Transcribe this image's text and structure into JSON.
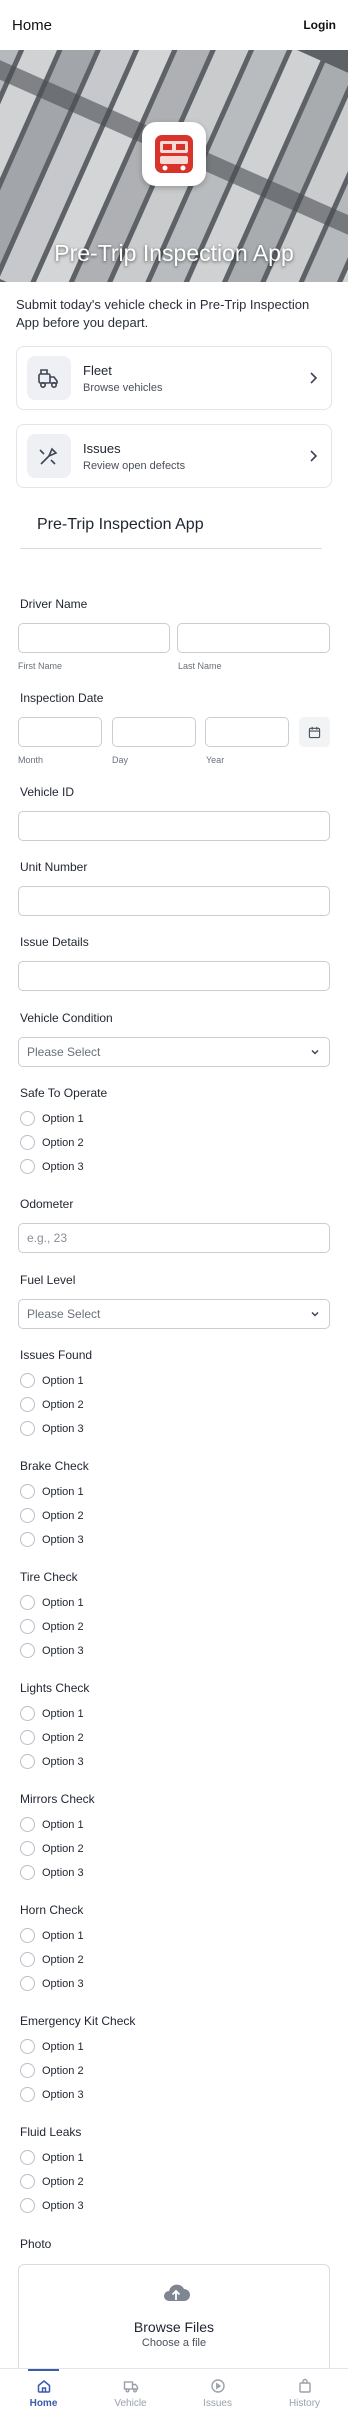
{
  "header": {
    "title": "Home",
    "login_label": "Login"
  },
  "hero": {
    "title": "Pre-Trip Inspection App"
  },
  "intro": "Submit today's vehicle check in Pre-Trip Inspection App before you depart.",
  "cards": [
    {
      "title": "Fleet",
      "subtitle": "Browse vehicles",
      "icon": "forklift-icon"
    },
    {
      "title": "Issues",
      "subtitle": "Review open defects",
      "icon": "tools-icon"
    }
  ],
  "form": {
    "title": "Pre-Trip Inspection App",
    "driver_name": {
      "label": "Driver Name",
      "first": "First Name",
      "last": "Last Name"
    },
    "inspection_date": {
      "label": "Inspection Date",
      "month": "Month",
      "day": "Day",
      "year": "Year"
    },
    "vehicle_id": {
      "label": "Vehicle ID"
    },
    "unit_number": {
      "label": "Unit Number"
    },
    "issue_details": {
      "label": "Issue Details"
    },
    "vehicle_condition": {
      "label": "Vehicle Condition",
      "placeholder": "Please Select"
    },
    "safe_to_operate": {
      "label": "Safe To Operate",
      "options": [
        "Option 1",
        "Option 2",
        "Option 3"
      ]
    },
    "odometer": {
      "label": "Odometer",
      "placeholder": "e.g., 23"
    },
    "fuel_level": {
      "label": "Fuel Level",
      "placeholder": "Please Select"
    },
    "issues_found": {
      "label": "Issues Found",
      "options": [
        "Option 1",
        "Option 2",
        "Option 3"
      ]
    },
    "brake_check": {
      "label": "Brake Check",
      "options": [
        "Option 1",
        "Option 2",
        "Option 3"
      ]
    },
    "tire_check": {
      "label": "Tire Check",
      "options": [
        "Option 1",
        "Option 2",
        "Option 3"
      ]
    },
    "lights_check": {
      "label": "Lights Check",
      "options": [
        "Option 1",
        "Option 2",
        "Option 3"
      ]
    },
    "mirrors_check": {
      "label": "Mirrors Check",
      "options": [
        "Option 1",
        "Option 2",
        "Option 3"
      ]
    },
    "horn_check": {
      "label": "Horn Check",
      "options": [
        "Option 1",
        "Option 2",
        "Option 3"
      ]
    },
    "emergency_kit_check": {
      "label": "Emergency Kit Check",
      "options": [
        "Option 1",
        "Option 2",
        "Option 3"
      ]
    },
    "fluid_leaks": {
      "label": "Fluid Leaks",
      "options": [
        "Option 1",
        "Option 2",
        "Option 3"
      ]
    },
    "photo": {
      "label": "Photo",
      "browse": "Browse Files",
      "choose": "Choose a file"
    }
  },
  "tabs": [
    {
      "label": "Home",
      "icon": "home-icon",
      "active": true
    },
    {
      "label": "Vehicle",
      "icon": "truck-icon",
      "active": false
    },
    {
      "label": "Issues",
      "icon": "play-circle-icon",
      "active": false
    },
    {
      "label": "History",
      "icon": "bag-icon",
      "active": false
    }
  ],
  "colors": {
    "accent": "#3b5bab",
    "border": "#c9cdd4",
    "app_icon_red": "#d9342b"
  }
}
